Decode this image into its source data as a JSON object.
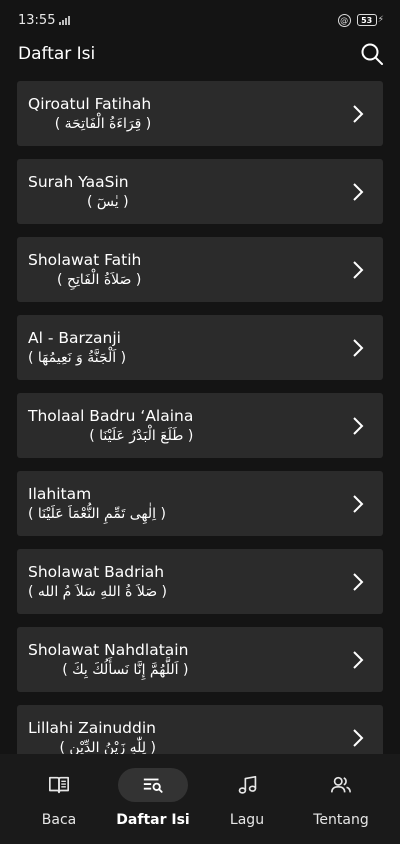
{
  "status_bar": {
    "time": "13:55",
    "battery_level": "53",
    "battery_percent": 53
  },
  "header": {
    "title": "Daftar Isi",
    "search_icon": "search-icon"
  },
  "list": {
    "items": [
      {
        "title": "Qiroatul Fatihah",
        "subtitle": "( قِرَاءَةُ الْفَاتِحَة )"
      },
      {
        "title": "Surah YaaSin",
        "subtitle": "( يٰسٓ )"
      },
      {
        "title": "Sholawat Fatih",
        "subtitle": "( صَلاَةُ الْفَاتِحِ )"
      },
      {
        "title": "Al - Barzanji",
        "subtitle": "( اَلْجَنَّةُ وَ نَعِيمُهَا )"
      },
      {
        "title": "Tholaal Badru ‘Alaina",
        "subtitle": "( طَلَعَ الْبَدْرُ عَلَيْنَا )"
      },
      {
        "title": "Ilahitam",
        "subtitle": "( اِلٰهِى تَمِّمِ النُّعْمَاَ عَلَيْنَا )"
      },
      {
        "title": "Sholawat Badriah",
        "subtitle": "( صَلاَ ةُ اللهِ سَلاَ مُ الله )"
      },
      {
        "title": "Sholawat Nahdlatain",
        "subtitle": "( اَللَّهُمَّ إِنَّا نَسأَلُكَ بِكَ )"
      },
      {
        "title": "Lillahi Zainuddin",
        "subtitle": "( لِلّٰهِ زَيْنُ الدِّيْنِ )"
      }
    ],
    "chevron_icon": "chevron-right-icon"
  },
  "bottom_nav": {
    "items": [
      {
        "label": "Baca",
        "icon": "book-icon",
        "active": false
      },
      {
        "label": "Daftar Isi",
        "icon": "list-search-icon",
        "active": true
      },
      {
        "label": "Lagu",
        "icon": "music-note-icon",
        "active": false
      },
      {
        "label": "Tentang",
        "icon": "people-icon",
        "active": false
      }
    ]
  },
  "colors": {
    "background": "#141414",
    "card": "#2b2b2b",
    "nav_background": "#1a1a1a",
    "nav_active_pill": "#333333",
    "text": "#ffffff"
  }
}
